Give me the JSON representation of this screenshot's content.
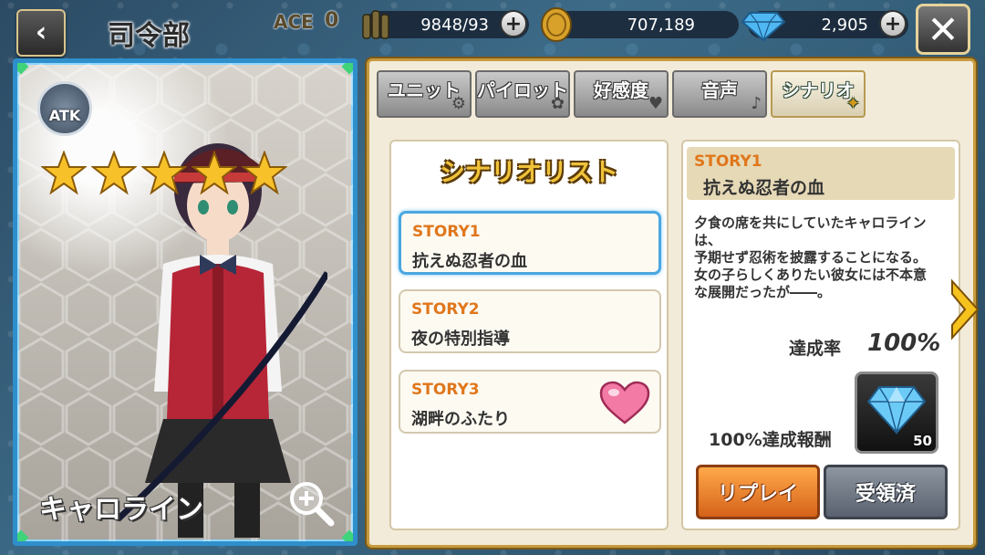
{
  "header": {
    "back_icon": "‹",
    "title": "司令部",
    "ace_label": "ACE",
    "ace_value": "0",
    "ammo": "9848/93",
    "coins": "707,189",
    "gems": "2,905",
    "plus_icon": "+",
    "close_icon": "✕"
  },
  "character": {
    "role_badge": "ATK",
    "stars": 5,
    "name": "キャロライン"
  },
  "tabs": [
    {
      "label": "ユニット",
      "deco": "⚙"
    },
    {
      "label": "パイロット",
      "deco": "✿"
    },
    {
      "label": "好感度",
      "deco": "♥"
    },
    {
      "label": "音声",
      "deco": "♪"
    },
    {
      "label": "シナリオ",
      "deco": "✦"
    }
  ],
  "scenario_list": {
    "title": "シナリオリスト",
    "items": [
      {
        "label": "STORY1",
        "title": "抗えぬ忍者の血"
      },
      {
        "label": "STORY2",
        "title": "夜の特別指導"
      },
      {
        "label": "STORY3",
        "title": "湖畔のふたり"
      }
    ]
  },
  "detail": {
    "label": "STORY1",
    "title": "抗えぬ忍者の血",
    "text": "夕食の席を共にしていたキャロライン\nは、\n予期せず忍術を披露することになる。\n女の子らしくありたい彼女には不本意\nな展開だったが――。",
    "rate_label": "達成率",
    "rate_value": "100%",
    "reward_label": "100%達成報酬",
    "reward_count": "50",
    "replay_label": "リプレイ",
    "claimed_label": "受領済"
  },
  "colors": {
    "accent_orange": "#e0771c",
    "card_frame": "#2f8fcb",
    "panel_border": "#c79a3d"
  }
}
